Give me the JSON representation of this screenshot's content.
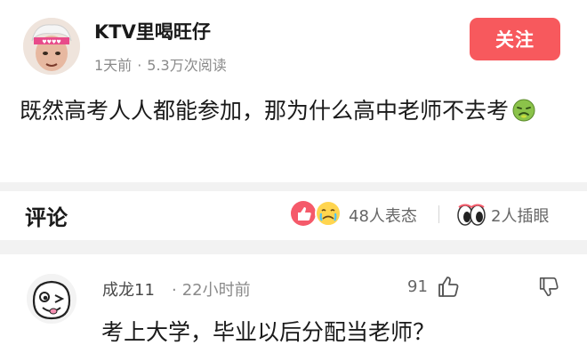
{
  "post": {
    "author": "KTV里喝旺仔",
    "time": "1天前",
    "views": "5.3万次阅读",
    "follow_label": "关注",
    "text": "既然高考人人都能参加，那为什么高中老师不去考",
    "emoji": "sick-face-icon"
  },
  "comments_bar": {
    "title": "评论",
    "reactions": "48人表态",
    "eyes": "2人插眼"
  },
  "comment": {
    "user": "成龙11",
    "time": "22小时前",
    "likes": "91",
    "text": "考上大学，毕业以后分配当老师？"
  },
  "colors": {
    "accent": "#f7595d",
    "meta": "#8a8a8a",
    "separator": "#f2f2f2"
  }
}
